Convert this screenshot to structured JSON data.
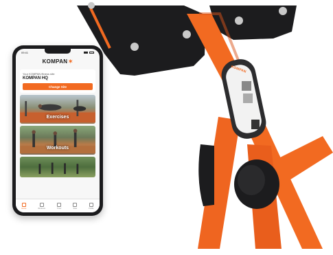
{
  "phone": {
    "status": {
      "time": "09:41"
    },
    "header": {
      "brand": "KOMPAN",
      "logo_icon": "kompan-star-icon"
    },
    "site_card": {
      "favorite_label": "Your KOMPAN fitness site:",
      "site_name": "KOMPAN HQ",
      "change_button": "Change Site"
    },
    "tiles": [
      {
        "label": "Exercises"
      },
      {
        "label": "Workouts"
      },
      {
        "label": ""
      }
    ],
    "tabbar": [
      {
        "label": "Home",
        "icon": "home-icon",
        "active": true
      },
      {
        "label": "Workouts",
        "icon": "workouts-icon",
        "active": false
      },
      {
        "label": "Timer",
        "icon": "timer-icon",
        "active": false
      },
      {
        "label": "Sites",
        "icon": "sites-icon",
        "active": false
      },
      {
        "label": "Profile",
        "icon": "profile-icon",
        "active": false
      }
    ]
  },
  "equipment": {
    "plate_brand": "KOMPAN",
    "frame_color": "#f26a21",
    "panel_color": "#1c1c1e"
  }
}
